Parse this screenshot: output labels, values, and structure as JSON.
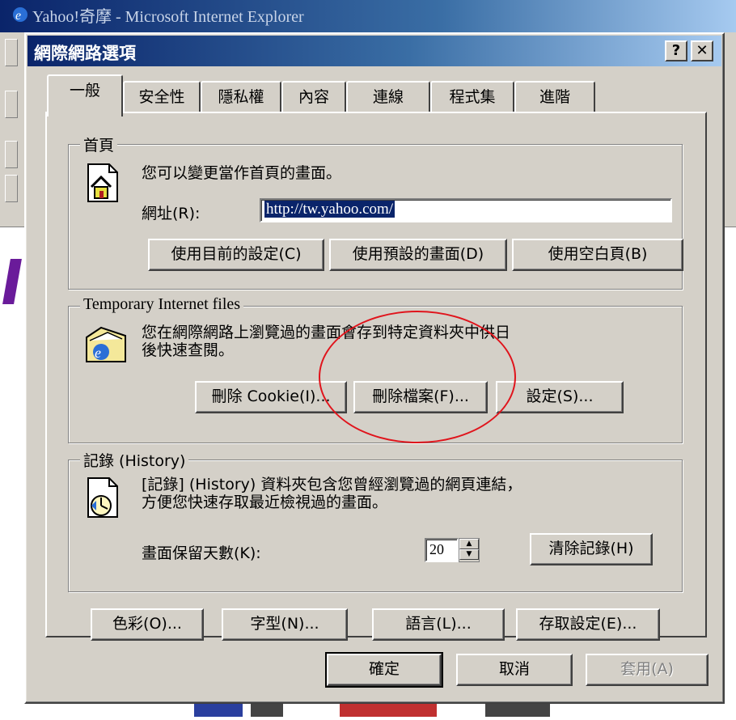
{
  "window": {
    "title": "Yahoo!奇摩 - Microsoft Internet Explorer"
  },
  "dialog": {
    "title": "網際網路選項",
    "help_label": "?",
    "close_label": "✕"
  },
  "tabs": [
    {
      "label": "一般",
      "active": true
    },
    {
      "label": "安全性"
    },
    {
      "label": "隱私權"
    },
    {
      "label": "內容"
    },
    {
      "label": "連線"
    },
    {
      "label": "程式集"
    },
    {
      "label": "進階"
    }
  ],
  "homepage": {
    "legend": "首頁",
    "description": "您可以變更當作首頁的畫面。",
    "address_label": "網址(R):",
    "address_value": "http://tw.yahoo.com/",
    "btn_current": "使用目前的設定(C)",
    "btn_default": "使用預設的畫面(D)",
    "btn_blank": "使用空白頁(B)"
  },
  "temp_files": {
    "legend": "Temporary Internet files",
    "description_line1": "您在網際網路上瀏覽過的畫面會存到特定資料夾中供日",
    "description_line2": "後快速查閱。",
    "btn_delete_cookie": "刪除 Cookie(I)...",
    "btn_delete_files": "刪除檔案(F)...",
    "btn_settings": "設定(S)..."
  },
  "history": {
    "legend": "記錄 (History)",
    "description_line1": "[記錄] (History) 資料夾包含您曾經瀏覽過的網頁連結，",
    "description_line2": "方便您快速存取最近檢視過的畫面。",
    "days_label": "畫面保留天數(K):",
    "days_value": "20",
    "btn_clear": "清除記錄(H)"
  },
  "bottom_buttons": {
    "colors": "色彩(O)...",
    "fonts": "字型(N)...",
    "languages": "語言(L)...",
    "accessibility": "存取設定(E)..."
  },
  "footer": {
    "ok": "確定",
    "cancel": "取消",
    "apply": "套用(A)"
  },
  "colors": {
    "titlebar_start": "#0a246a",
    "titlebar_end": "#a6caf0",
    "dialog_face": "#d4d0c8",
    "annotation_circle": "#e0141c"
  }
}
